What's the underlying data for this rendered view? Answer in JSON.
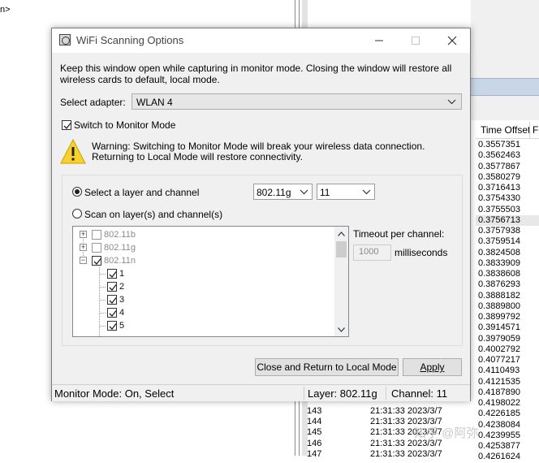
{
  "background": {
    "left_text": "n>",
    "column_header": "Time Offset",
    "column_header_next": "F",
    "time_offsets": [
      "0.3557351",
      "0.3562463",
      "0.3577867",
      "0.3580279",
      "0.3716413",
      "0.3754330",
      "0.3755503",
      "0.3756713",
      "0.3757938",
      "0.3759514",
      "0.3824508",
      "0.3833909",
      "0.3838608",
      "0.3876293",
      "0.3888182",
      "0.3889800",
      "0.3899792",
      "0.3914571",
      "0.3979059",
      "0.4002792",
      "0.4077217",
      "0.4110493",
      "0.4121535",
      "0.4187890",
      "0.4198022",
      "0.4226185",
      "0.4238084",
      "0.4239955",
      "0.4253877",
      "0.4261624"
    ],
    "rows": [
      {
        "num": "143",
        "time": "21:31:33 2023/3/7"
      },
      {
        "num": "144",
        "time": "21:31:33 2023/3/7"
      },
      {
        "num": "145",
        "time": "21:31:33 2023/3/7"
      },
      {
        "num": "146",
        "time": "21:31:33 2023/3/7"
      },
      {
        "num": "147",
        "time": "21:31:33 2023/3/7"
      }
    ],
    "watermark": "知乎 @阿弥"
  },
  "dialog": {
    "title": "WiFi Scanning Options",
    "intro": "Keep this window open while capturing in monitor mode. Closing the window will restore all wireless cards to default, local mode.",
    "adapter_label": "Select adapter:",
    "adapter_value": "WLAN 4",
    "monitor_mode_label": "Switch to Monitor Mode",
    "monitor_mode_checked": true,
    "warning": "Warning: Switching to Monitor Mode will break your wireless data connection. Returning to Local Mode will restore connectivity.",
    "radio_select_layer": "Select a layer and channel",
    "radio_scan": "Scan on layer(s) and channel(s)",
    "layer_value": "802.11g",
    "channel_value": "11",
    "tree": {
      "layers": [
        "802.11b",
        "802.11g",
        "802.11n"
      ],
      "channels": [
        "1",
        "2",
        "3",
        "4",
        "5"
      ]
    },
    "timeout_label": "Timeout per channel:",
    "timeout_value": "1000",
    "timeout_unit": "milliseconds",
    "btn_close": "Close and Return to Local Mode",
    "btn_apply": "Apply",
    "status": {
      "monitor": "Monitor Mode: On, Select",
      "layer": "Layer: 802.11g",
      "channel": "Channel: 11"
    }
  }
}
